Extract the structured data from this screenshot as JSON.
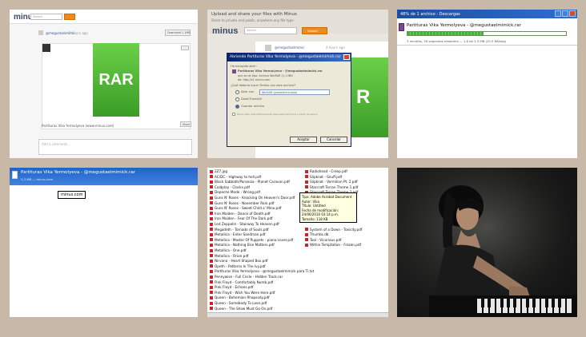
{
  "panel1": {
    "logo": "minus",
    "search_placeholder": "Search",
    "username": "@megustaelmimic",
    "timestamp": "4 hours ago",
    "download_button": "Download 1.1MB",
    "rar_label": "RAR",
    "filename": "Partituras Vika Yermolyeva (www.minus.com)",
    "share_label": "Share",
    "comment_placeholder": "Add a comment..."
  },
  "panel2": {
    "header_line1": "Upload and share your files with Minus",
    "header_line2": "Share to private and public, anywhere any file type",
    "logo": "minus",
    "search_placeholder": "Search",
    "upload_button": "Upload",
    "username": "@megustaelmimic",
    "timestamp": "4 hours ago",
    "dialog": {
      "title": "Abriendo Partituras Vika Yermolyeva - @megustaelmimick.rar",
      "intro": "Ha escogido abrir:",
      "file": "Partituras Vika Yermolyeva - @megustaelmimick.rar",
      "type": "que es de tipo: Archivo WinRAR (1,1 MB)",
      "from": "de: http://s1.minus.com",
      "question": "¿Qué debería hacer Firefox con este archivo?",
      "option_open": "Abrir con",
      "open_with": "WinRAR (predeterminada)",
      "option_download": "DownThemAll!",
      "option_save": "Guardar archivo",
      "remember": "Hacer esto automáticamente para estos archivos a partir de ahora.",
      "accept": "Aceptar",
      "cancel": "Cancelar"
    },
    "footer": "Partituras Vika Yermolyeva (www.minus.com) Items"
  },
  "panel3": {
    "title": "48% de 1 archivo - Descargas",
    "filename": "Partituras Vika Yermolyeva - @megustaelmimick.rar",
    "status": "3 minutos, 50 segundos restantes — 1,6 de 3,3 MB (20,5 KB/seg)",
    "progress": 0.48
  },
  "panel4": {
    "filename": "Partituras Vika Yermolyeva - @megustaelmimick.rar",
    "source": "3,3 MB — minus.com",
    "tooltip": "minus.com"
  },
  "panel5": {
    "col1": [
      "2Z7.jpg",
      "AC/DC - Highway to hell.pdf",
      "Black Sabbath/Paranoia - Planet Caravan.pdf",
      "Coldplay - Clocks.pdf",
      "Depeche Mode - Wrong.pdf",
      "Guns N' Roses - Knocking On Heaven's Door.pdf",
      "Guns N' Roses - November Rain.pdf",
      "Guns N' Roses - Sweet Child o' Mine.pdf",
      "Iron Maiden - Dance of Death.pdf",
      "Iron Maiden - Fear Of The Dark.pdf",
      "Led Zeppelin - Stairway To Heaven.pdf",
      "Megadeth - Tornado of Souls.pdf",
      "Metallica - Enter Sandman.pdf",
      "Metallica - Master Of Puppets - piano-cover.pdf",
      "Metallica - Nothing Else Matters.pdf",
      "Metallica - One.pdf",
      "Metallica - Orion.pdf",
      "Nirvana - Heart Shaped Box.pdf",
      "Opeth - Patterns In The Ivy.pdf",
      "Partituras Vika Yermolyeva - @megustaelmimick para Ti.txt",
      "Pennywise - Full Circle - Hidden Track.rar",
      "Pink Floyd - Comfortably Numb.pdf",
      "Pink Floyd - Echoes.pdf",
      "Pink Floyd - Wish You Were Here.pdf",
      "Queen - Bohemian Rhapsody.pdf",
      "Queen - Somebody To Love.pdf",
      "Queen - The Show Must Go On.pdf"
    ],
    "col2": [
      "Radiohead - Creep.pdf",
      "Slipknot - Snuff.pdf",
      "Slipknot - Vermilion Pt. 2.pdf",
      "Starcraft Terran Theme 1.pdf",
      "Starcraft Terran Theme 2.pdf",
      "",
      "",
      "",
      "",
      "",
      "",
      "System of a Down - Toxicity.pdf",
      "Thumbs.db",
      "Tool - Vicarious.pdf",
      "Within Temptation - Frozen.pdf"
    ],
    "info": {
      "type": "Tipo: Adobe Acrobat Document",
      "author": "Autor: Vika",
      "title": "Título: Untitled",
      "modified": "Fecha de modificación: 24/06/2010 03:14 p.m.",
      "size": "Tamaño: 118 KB"
    }
  },
  "colors": {
    "accent_orange": "#f08a1a",
    "xp_blue": "#1c4ea0",
    "rar_green": "#4cb234"
  }
}
